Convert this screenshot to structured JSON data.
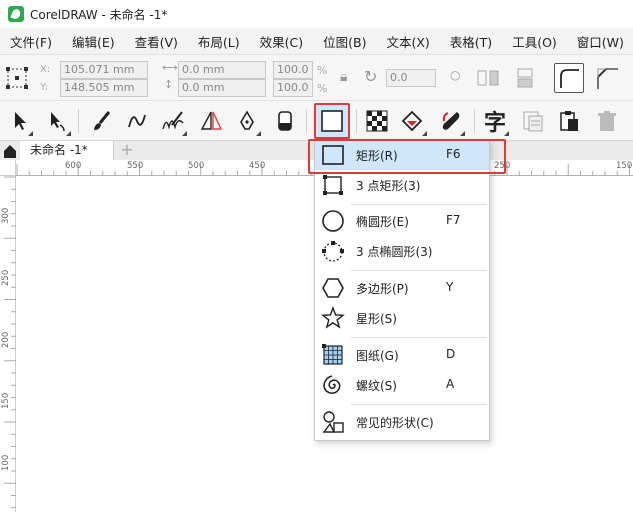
{
  "window": {
    "title": "CorelDRAW - 未命名 -1*"
  },
  "menubar": [
    "文件(F)",
    "编辑(E)",
    "查看(V)",
    "布局(L)",
    "效果(C)",
    "位图(B)",
    "文本(X)",
    "表格(T)",
    "工具(O)",
    "窗口(W)"
  ],
  "propbar": {
    "x_label": "X:",
    "y_label": "Y:",
    "x_value": "105.071 mm",
    "y_value": "148.505 mm",
    "w_value": "0.0 mm",
    "h_value": "0.0 mm",
    "sx_value": "100.0",
    "sy_value": "100.0",
    "percent": "%",
    "rotation_value": "0.0"
  },
  "toolbar": {
    "text_tool_glyph": "字",
    "active_tool": "rectangle-tool"
  },
  "tabs": {
    "doc_tab": "未命名 -1*",
    "add_tab": "+"
  },
  "ruler": {
    "h_labels": [
      "600",
      "550",
      "500",
      "450",
      "250",
      "150"
    ],
    "v_labels": [
      "300",
      "250",
      "200",
      "150",
      "100"
    ]
  },
  "dropdown": {
    "items": [
      {
        "label": "矩形(R)",
        "key": "F6",
        "icon": "rectangle-icon"
      },
      {
        "label": "3 点矩形(3)",
        "key": "",
        "icon": "three-point-rectangle-icon"
      },
      {
        "label": "椭圆形(E)",
        "key": "F7",
        "icon": "ellipse-icon"
      },
      {
        "label": "3 点椭圆形(3)",
        "key": "",
        "icon": "three-point-ellipse-icon"
      },
      {
        "label": "多边形(P)",
        "key": "Y",
        "icon": "polygon-icon"
      },
      {
        "label": "星形(S)",
        "key": "",
        "icon": "star-icon"
      },
      {
        "label": "图纸(G)",
        "key": "D",
        "icon": "graph-paper-icon"
      },
      {
        "label": "螺纹(S)",
        "key": "A",
        "icon": "spiral-icon"
      },
      {
        "label": "常见的形状(C)",
        "key": "",
        "icon": "common-shapes-icon"
      }
    ]
  },
  "colors": {
    "accent_highlight": "#cfe6fb",
    "annotation_red": "#e03a3a"
  }
}
